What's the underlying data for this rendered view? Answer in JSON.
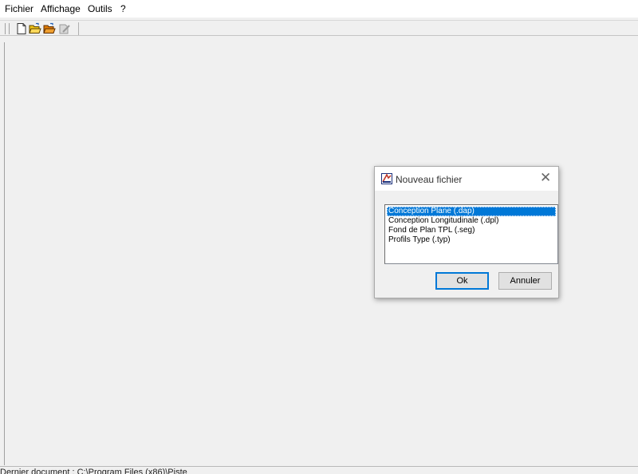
{
  "menubar": {
    "items": [
      "Fichier",
      "Affichage",
      "Outils",
      "?"
    ]
  },
  "toolbar": {
    "buttons": [
      "new-file-icon",
      "open-folder-icon",
      "open-recent-icon",
      "disabled-tool-icon"
    ]
  },
  "statusbar": {
    "text": "Dernier document : C:\\Program Files (x86)\\Piste"
  },
  "dialog": {
    "title": "Nouveau fichier",
    "icon": "app-icon",
    "close_glyph": "✕",
    "list": {
      "items": [
        "Conception Plane (.dap)",
        "Conception Longitudinale (.dpl)",
        "Fond de Plan TPL (.seg)",
        "Profils Type (.typ)"
      ],
      "selected_item": "Conception Plane (.dap)"
    },
    "ok_label": "Ok",
    "cancel_label": "Annuler"
  },
  "colors": {
    "selection": "#0078d7",
    "window_bg": "#f0f0f0",
    "folder_yellow": "#f0c419",
    "folder_orange": "#e07b00"
  }
}
